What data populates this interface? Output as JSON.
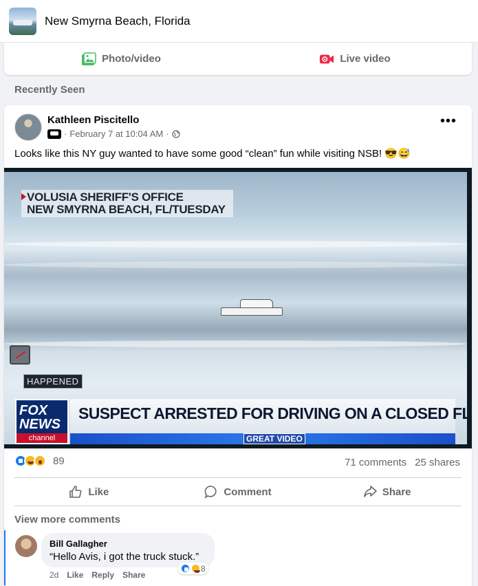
{
  "group": {
    "title": "New Smyrna Beach, Florida"
  },
  "composer": {
    "photo_label": "Photo/video",
    "live_label": "Live video"
  },
  "section": {
    "label": "Recently Seen"
  },
  "post": {
    "author": "Kathleen Piscitello",
    "timestamp": "February 7 at 10:04 AM",
    "separator": "·",
    "text": "Looks like this NY guy wanted to have some good “clean” fun while visiting NSB! 😎😅",
    "media": {
      "lower_third_1": "VOLUSIA SHERIFF'S OFFICE",
      "lower_third_2": "NEW SMYRNA BEACH, FL/TUESDAY",
      "happened": "HAPPENED",
      "logo_1": "FOX",
      "logo_2": "NEWS",
      "logo_3": "channel",
      "headline": "SUSPECT ARRESTED FOR DRIVING ON A CLOSED FL BEACH",
      "subtag": "GREAT VIDEO"
    },
    "reaction_count": "89",
    "comments_count": "71 comments",
    "shares_count": "25 shares",
    "actions": {
      "like": "Like",
      "comment": "Comment",
      "share": "Share"
    },
    "view_more": "View more comments"
  },
  "comment": {
    "author": "Bill Gallagher",
    "text": "“Hello Avis, i got the truck stuck.”",
    "age": "2d",
    "like": "Like",
    "reply": "Reply",
    "share": "Share",
    "reaction_count": "8"
  },
  "colors": {
    "accent": "#1877f2",
    "muted": "#65676b",
    "fox_red": "#c8102e",
    "fox_blue": "#0a2a6e"
  }
}
